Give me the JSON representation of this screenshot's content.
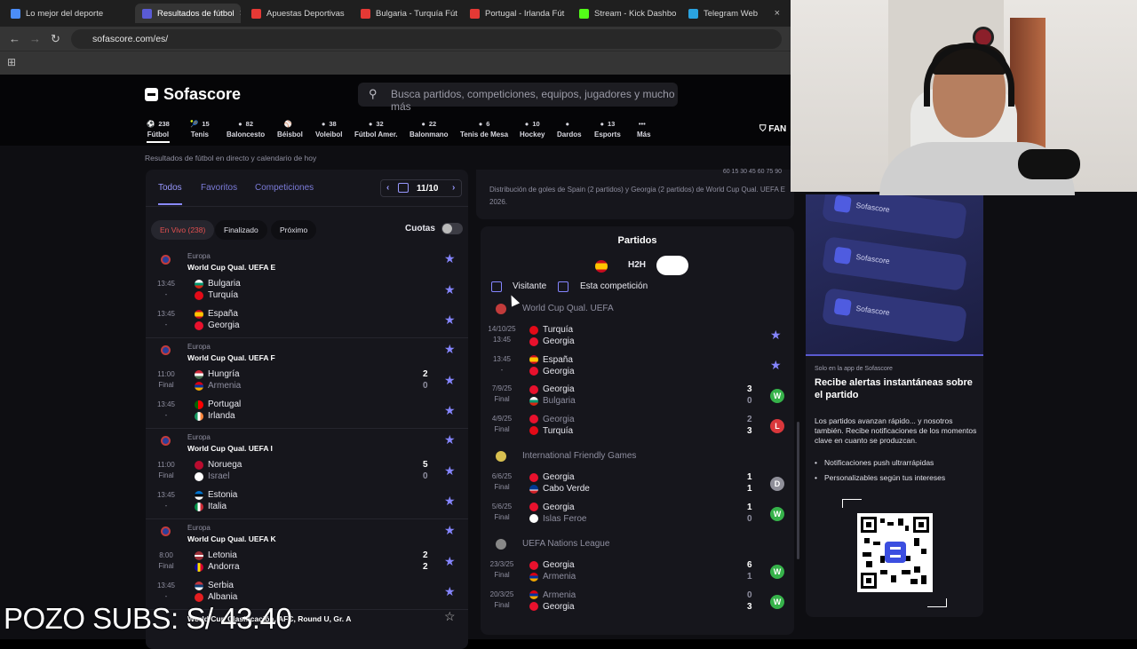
{
  "tabs": [
    {
      "label": "Lo mejor del deporte",
      "color": "#4b8df8"
    },
    {
      "label": "Resultados de fútbol",
      "color": "#5a5bd5"
    },
    {
      "label": "Apuestas Deportivas",
      "color": "#e53935"
    },
    {
      "label": "Bulgaria - Turquía Fút",
      "color": "#e53935"
    },
    {
      "label": "Portugal - Irlanda Fút",
      "color": "#e53935"
    },
    {
      "label": "Stream - Kick Dashbo",
      "color": "#53fc18"
    },
    {
      "label": "Telegram Web",
      "color": "#2aa3e0"
    }
  ],
  "url": "sofascore.com/es/",
  "site": {
    "logo": "Sofascore",
    "search_placeholder": "Busca partidos, competiciones, equipos, jugadores y mucho más",
    "fan": "FAN",
    "subtitle": "Resultados de fútbol en directo y calendario de hoy"
  },
  "sports": [
    {
      "count": "238",
      "label": "Fútbol"
    },
    {
      "count": "15",
      "label": "Tenis"
    },
    {
      "count": "82",
      "label": "Baloncesto"
    },
    {
      "count": "",
      "label": "Béisbol"
    },
    {
      "count": "38",
      "label": "Voleibol"
    },
    {
      "count": "32",
      "label": "Fútbol Amer."
    },
    {
      "count": "22",
      "label": "Balonmano"
    },
    {
      "count": "6",
      "label": "Tenis de Mesa"
    },
    {
      "count": "10",
      "label": "Hockey"
    },
    {
      "count": "",
      "label": "Dardos"
    },
    {
      "count": "13",
      "label": "Esports"
    },
    {
      "count": "",
      "label": "Más"
    }
  ],
  "left": {
    "tabs": [
      "Todos",
      "Favoritos",
      "Competiciones"
    ],
    "date": "11/10",
    "chips": [
      "En Vivo (238)",
      "Finalizado",
      "Próximo"
    ],
    "odds": "Cuotas",
    "groups": [
      {
        "region": "Europa",
        "comp": "World Cup Qual. UEFA E",
        "matches": [
          {
            "time": "13:45",
            "status": "-",
            "home": "Bulgaria",
            "away": "Turquía",
            "hs": "",
            "as": ""
          },
          {
            "time": "13:45",
            "status": "-",
            "home": "España",
            "away": "Georgia",
            "hs": "",
            "as": ""
          }
        ]
      },
      {
        "region": "Europa",
        "comp": "World Cup Qual. UEFA F",
        "matches": [
          {
            "time": "11:00",
            "status": "Final",
            "home": "Hungría",
            "away": "Armenia",
            "hs": "2",
            "as": "0"
          },
          {
            "time": "13:45",
            "status": "-",
            "home": "Portugal",
            "away": "Irlanda",
            "hs": "",
            "as": ""
          }
        ]
      },
      {
        "region": "Europa",
        "comp": "World Cup Qual. UEFA I",
        "matches": [
          {
            "time": "11:00",
            "status": "Final",
            "home": "Noruega",
            "away": "Israel",
            "hs": "5",
            "as": "0"
          },
          {
            "time": "13:45",
            "status": "-",
            "home": "Estonia",
            "away": "Italia",
            "hs": "",
            "as": ""
          }
        ]
      },
      {
        "region": "Europa",
        "comp": "World Cup Qual. UEFA K",
        "matches": [
          {
            "time": "8:00",
            "status": "Final",
            "home": "Letonia",
            "away": "Andorra",
            "hs": "2",
            "as": "2"
          },
          {
            "time": "13:45",
            "status": "-",
            "home": "Serbia",
            "away": "Albania",
            "hs": "",
            "as": ""
          }
        ]
      }
    ],
    "last_comp": "World Cup Clasificación, AFC, Round U, Gr. A"
  },
  "mid": {
    "top_numbers": "60  15  30  45  60  75  90",
    "description": "Distribución de goles de Spain (2 partidos) y Georgia (2 partidos) de World Cup Qual. UEFA E 2026.",
    "title": "Partidos",
    "h2h": "H2H",
    "cb1": "Visitante",
    "cb2": "Esta competición",
    "sections": [
      {
        "name": "World Cup Qual. UEFA",
        "matches": [
          {
            "date": "14/10/25",
            "status": "13:45",
            "home": "Turquía",
            "away": "Georgia",
            "hs": "",
            "as": "",
            "res": "star",
            "rc": "#8585ff"
          },
          {
            "date": "13:45",
            "status": "-",
            "home": "España",
            "away": "Georgia",
            "hs": "",
            "as": "",
            "res": "star",
            "rc": "#8585ff"
          },
          {
            "date": "7/9/25",
            "status": "Final",
            "home": "Georgia",
            "away": "Bulgaria",
            "hs": "3",
            "as": "0",
            "res": "W",
            "rc": "#36b24a"
          },
          {
            "date": "4/9/25",
            "status": "Final",
            "home": "Georgia",
            "away": "Turquía",
            "hs": "2",
            "as": "3",
            "res": "L",
            "rc": "#d9373b"
          }
        ]
      },
      {
        "name": "International Friendly Games",
        "matches": [
          {
            "date": "6/6/25",
            "status": "Final",
            "home": "Georgia",
            "away": "Cabo Verde",
            "hs": "1",
            "as": "1",
            "res": "D",
            "rc": "#8f8f99"
          },
          {
            "date": "5/6/25",
            "status": "Final",
            "home": "Georgia",
            "away": "Islas Feroe",
            "hs": "1",
            "as": "0",
            "res": "W",
            "rc": "#36b24a"
          }
        ]
      },
      {
        "name": "UEFA Nations League",
        "matches": [
          {
            "date": "23/3/25",
            "status": "Final",
            "home": "Georgia",
            "away": "Armenia",
            "hs": "6",
            "as": "1",
            "res": "W",
            "rc": "#36b24a"
          },
          {
            "date": "20/3/25",
            "status": "Final",
            "home": "Armenia",
            "away": "Georgia",
            "hs": "0",
            "as": "3",
            "res": "W",
            "rc": "#36b24a"
          }
        ]
      }
    ]
  },
  "promo": {
    "card_text": "Sofascore",
    "tag": "Solo en la app de Sofascore",
    "headline": "Recibe alertas instantáneas sobre el partido",
    "body": "Los partidos avanzan rápido... y nosotros también. Recibe notificaciones de los momentos clave en cuanto se produzcan.",
    "bullets": [
      "Notificaciones push ultrarrápidas",
      "Personalizables según tus intereses"
    ]
  },
  "overlay": "POZO SUBS: S/ 43.40"
}
